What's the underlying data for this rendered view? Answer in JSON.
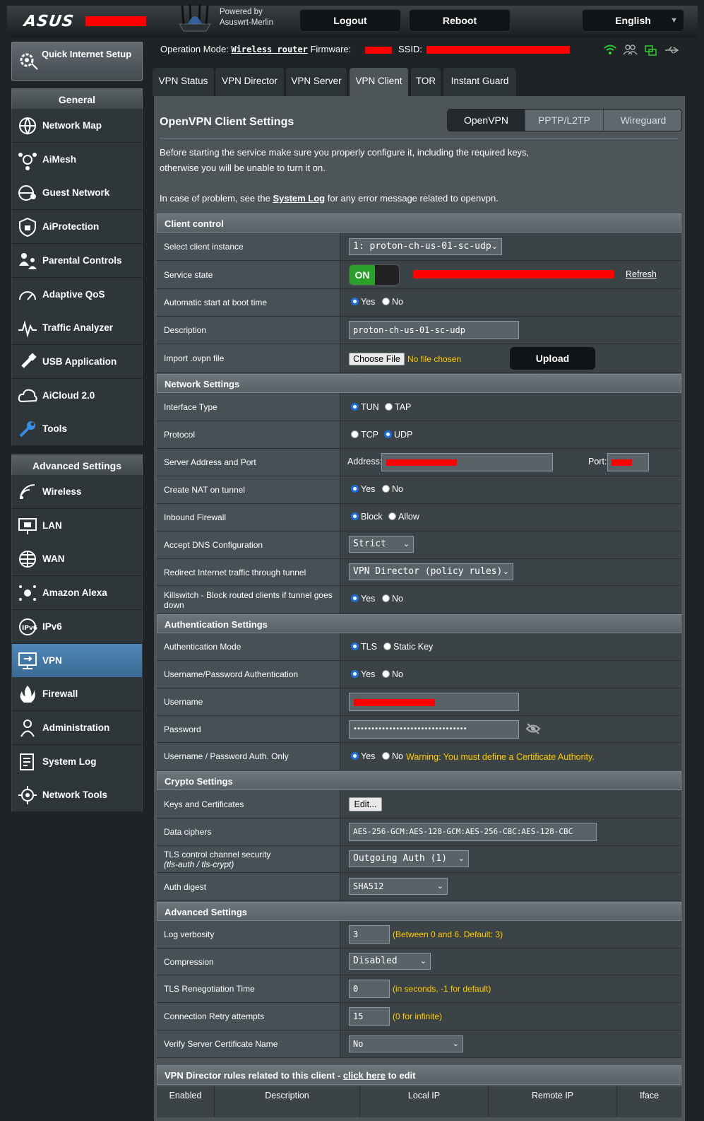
{
  "header": {
    "brand": "ASUS",
    "powered_by": "Powered by",
    "firmware_name": "Asuswrt-Merlin",
    "logout": "Logout",
    "reboot": "Reboot",
    "language": "English"
  },
  "status": {
    "op_mode_label": "Operation Mode:",
    "op_mode_value": "Wireless router",
    "firmware_label": "Firmware:",
    "ssid_label": "SSID:"
  },
  "sidebar": {
    "qis": "Quick Internet Setup",
    "general_title": "General",
    "general_items": [
      {
        "label": "Network Map",
        "icon": "network-map-icon"
      },
      {
        "label": "AiMesh",
        "icon": "aimesh-icon"
      },
      {
        "label": "Guest Network",
        "icon": "guest-network-icon"
      },
      {
        "label": "AiProtection",
        "icon": "aiprotection-icon"
      },
      {
        "label": "Parental Controls",
        "icon": "parental-controls-icon"
      },
      {
        "label": "Adaptive QoS",
        "icon": "qos-icon"
      },
      {
        "label": "Traffic Analyzer",
        "icon": "traffic-analyzer-icon"
      },
      {
        "label": "USB Application",
        "icon": "usb-icon"
      },
      {
        "label": "AiCloud 2.0",
        "icon": "aicloud-icon"
      },
      {
        "label": "Tools",
        "icon": "tools-icon"
      }
    ],
    "advanced_title": "Advanced Settings",
    "advanced_items": [
      {
        "label": "Wireless",
        "icon": "wireless-icon"
      },
      {
        "label": "LAN",
        "icon": "lan-icon"
      },
      {
        "label": "WAN",
        "icon": "wan-icon"
      },
      {
        "label": "Amazon Alexa",
        "icon": "alexa-icon"
      },
      {
        "label": "IPv6",
        "icon": "ipv6-icon"
      },
      {
        "label": "VPN",
        "icon": "vpn-icon"
      },
      {
        "label": "Firewall",
        "icon": "firewall-icon"
      },
      {
        "label": "Administration",
        "icon": "administration-icon"
      },
      {
        "label": "System Log",
        "icon": "system-log-icon"
      },
      {
        "label": "Network Tools",
        "icon": "network-tools-icon"
      }
    ]
  },
  "tabs": [
    "VPN Status",
    "VPN Director",
    "VPN Server",
    "VPN Client",
    "TOR",
    "Instant Guard"
  ],
  "page": {
    "title": "OpenVPN Client Settings",
    "segments": [
      "OpenVPN",
      "PPTP/L2TP",
      "Wireguard"
    ],
    "intro1": "Before starting the service make sure you properly configure it, including the required keys,",
    "intro2": "otherwise you will be unable to turn it on.",
    "intro3_pre": "In case of problem, see the ",
    "intro3_link": "System Log",
    "intro3_post": " for any error message related to openvpn."
  },
  "client_control": {
    "title": "Client control",
    "select_instance_label": "Select client instance",
    "select_instance_value": "1: proton-ch-us-01-sc-udp",
    "service_state_label": "Service state",
    "service_state_value": "ON",
    "refresh": "Refresh",
    "autostart_label": "Automatic start at boot time",
    "description_label": "Description",
    "description_value": "proton-ch-us-01-sc-udp",
    "import_label": "Import .ovpn file",
    "choose_file": "Choose File",
    "no_file": "No file chosen",
    "upload": "Upload"
  },
  "radio": {
    "yes": "Yes",
    "no": "No",
    "tun": "TUN",
    "tap": "TAP",
    "tcp": "TCP",
    "udp": "UDP",
    "block": "Block",
    "allow": "Allow",
    "tls": "TLS",
    "static_key": "Static Key"
  },
  "network": {
    "title": "Network Settings",
    "interface_label": "Interface Type",
    "protocol_label": "Protocol",
    "server_label": "Server Address and Port",
    "address_label": "Address:",
    "port_label": "Port:",
    "nat_label": "Create NAT on tunnel",
    "firewall_label": "Inbound Firewall",
    "dns_label": "Accept DNS Configuration",
    "dns_value": "Strict",
    "redirect_label": "Redirect Internet traffic through tunnel",
    "redirect_value": "VPN Director (policy rules)",
    "killswitch_label": "Killswitch - Block routed clients if tunnel goes down"
  },
  "auth": {
    "title": "Authentication Settings",
    "mode_label": "Authentication Mode",
    "userpass_label": "Username/Password Authentication",
    "username_label": "Username",
    "password_label": "Password",
    "password_value": "••••••••••••••••••••••••••••••••",
    "authonly_label": "Username / Password Auth. Only",
    "warning": "Warning: You must define a Certificate Authority."
  },
  "crypto": {
    "title": "Crypto Settings",
    "keys_label": "Keys and Certificates",
    "edit": "Edit...",
    "ciphers_label": "Data ciphers",
    "ciphers_value": "AES-256-GCM:AES-128-GCM:AES-256-CBC:AES-128-CBC",
    "tls_label": "TLS control channel security",
    "tls_sub": "(tls-auth / tls-crypt)",
    "tls_value": "Outgoing Auth (1)",
    "digest_label": "Auth digest",
    "digest_value": "SHA512"
  },
  "advanced": {
    "title": "Advanced Settings",
    "verb_label": "Log verbosity",
    "verb_value": "3",
    "verb_hint": "(Between 0 and 6. Default: 3)",
    "comp_label": "Compression",
    "comp_value": "Disabled",
    "reneg_label": "TLS Renegotiation Time",
    "reneg_value": "0",
    "reneg_hint": "(in seconds, -1 for default)",
    "retry_label": "Connection Retry attempts",
    "retry_value": "15",
    "retry_hint": "(0 for infinite)",
    "verify_label": "Verify Server Certificate Name",
    "verify_value": "No"
  },
  "director": {
    "title_pre": "VPN Director rules related to this client - ",
    "title_link": "click here",
    "title_post": " to edit",
    "columns": [
      "Enabled",
      "Description",
      "Local IP",
      "Remote IP",
      "Iface"
    ]
  }
}
